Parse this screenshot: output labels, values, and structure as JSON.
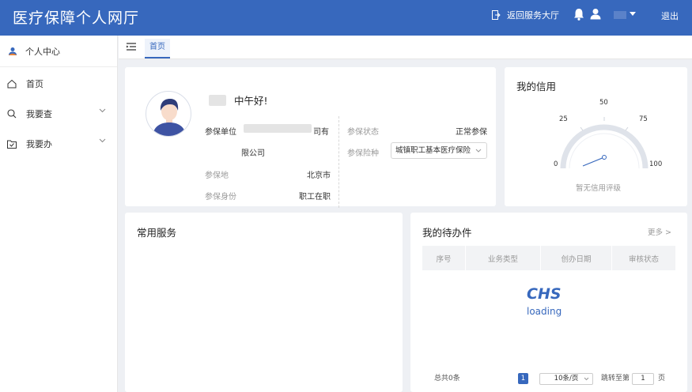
{
  "header": {
    "title": "医疗保障个人网厅",
    "return_label": "返回服务大厅",
    "logout_label": "退出"
  },
  "sidebar": {
    "personal_center": "个人中心",
    "items": [
      {
        "label": "首页"
      },
      {
        "label": "我要查"
      },
      {
        "label": "我要办"
      }
    ]
  },
  "tabs": [
    {
      "label": "首页"
    }
  ],
  "profile": {
    "greeting": "中午好!",
    "unit_label": "参保单位",
    "unit_value_tail": "司有",
    "unit_value_line2": "限公司",
    "region_label": "参保地",
    "region_value": "北京市",
    "identity_label": "参保身份",
    "identity_value": "职工在职",
    "status_label": "参保状态",
    "status_value": "正常参保",
    "insurance_label": "参保险种",
    "insurance_selected": "城镇职工基本医疗保险"
  },
  "credit": {
    "title": "我的信用",
    "ticks": [
      "0",
      "25",
      "50",
      "75",
      "100"
    ],
    "gauge_value": 0,
    "no_rating": "暂无信用评级"
  },
  "services": {
    "title": "常用服务"
  },
  "todo": {
    "title": "我的待办件",
    "more": "更多 >",
    "columns": [
      "序号",
      "业务类型",
      "创办日期",
      "审核状态"
    ],
    "loading_logo": "CHS",
    "loading_text": "loading",
    "total": "总共0条",
    "current_page": "1",
    "page_size": "10条/页",
    "jump_label": "跳转至第",
    "jump_value": "1",
    "page_suffix": "页"
  },
  "colors": {
    "primary": "#3768bd",
    "background": "#eef0f4"
  }
}
